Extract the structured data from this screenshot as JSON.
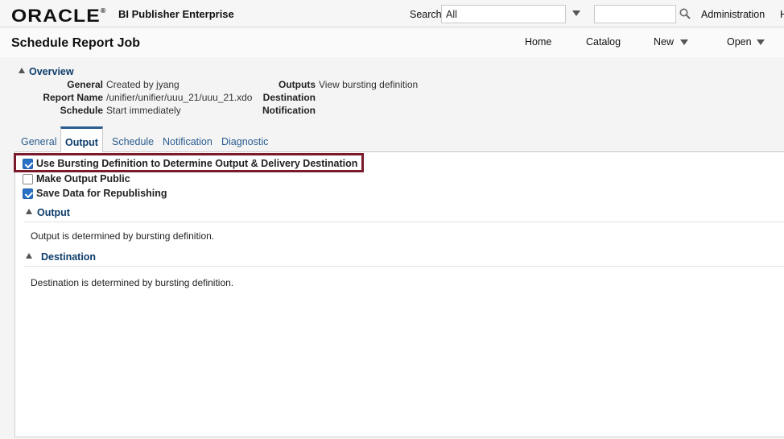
{
  "header": {
    "logo": "ORACLE",
    "logo_mark": "®",
    "product": "BI Publisher Enterprise",
    "search_label": "Search",
    "search_scope": "All",
    "search_query": "",
    "admin_label": "Administration",
    "help_label": "H"
  },
  "page": {
    "title": "Schedule Report Job"
  },
  "nav": {
    "home": "Home",
    "catalog": "Catalog",
    "new": "New",
    "open": "Open"
  },
  "overview": {
    "title": "Overview",
    "general_label": "General",
    "general_value": "Created by jyang",
    "report_name_label": "Report Name",
    "report_name_value": "/unifier/unifier/uuu_21/uuu_21.xdo",
    "schedule_label": "Schedule",
    "schedule_value": "Start immediately",
    "outputs_label": "Outputs",
    "outputs_value": "View bursting definition",
    "destination_label": "Destination",
    "notification_label": "Notification"
  },
  "tabs": [
    {
      "label": "General"
    },
    {
      "label": "Output",
      "active": true
    },
    {
      "label": "Schedule"
    },
    {
      "label": "Notification"
    },
    {
      "label": "Diagnostic"
    }
  ],
  "options": {
    "use_bursting": {
      "label": "Use Bursting Definition to Determine Output & Delivery Destination",
      "checked": true
    },
    "make_public": {
      "label": "Make Output Public",
      "checked": false
    },
    "save_data": {
      "label": "Save Data for Republishing",
      "checked": true
    }
  },
  "sections": {
    "output_title": "Output",
    "output_text": "Output is determined by bursting definition.",
    "destination_title": "Destination",
    "destination_text": "Destination is determined by bursting definition."
  },
  "colors": {
    "highlight_border": "#7b1a2a",
    "link": "#2a5d8f",
    "heading": "#0d3d6b",
    "checkbox": "#2871c4"
  }
}
